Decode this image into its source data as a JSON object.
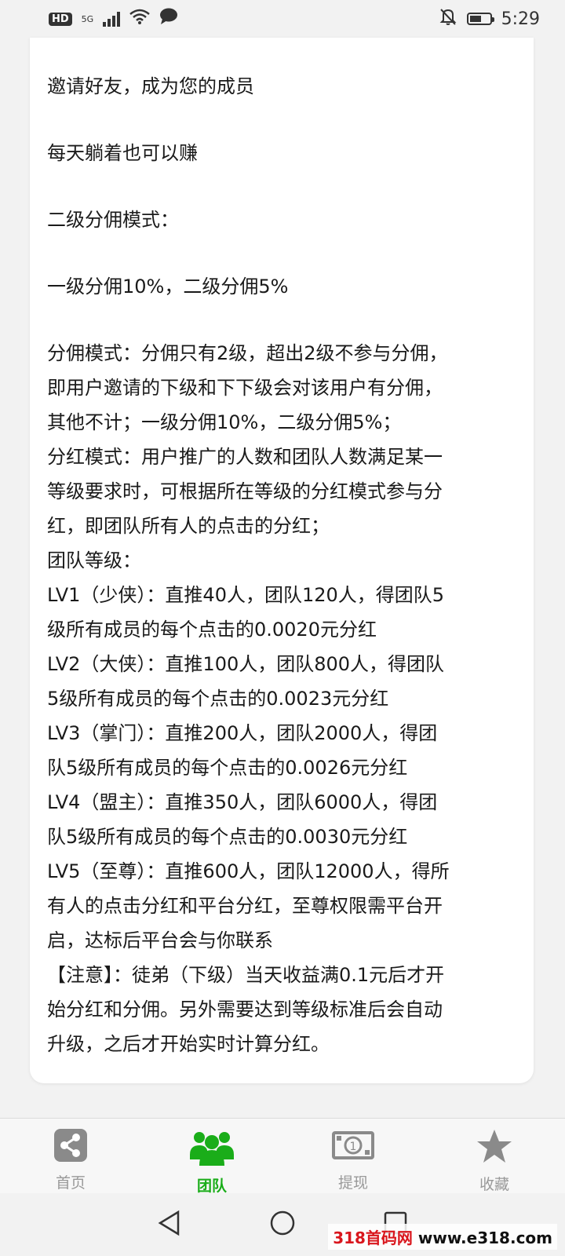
{
  "status_bar": {
    "hd": "HD",
    "network": "5G",
    "time": "5:29"
  },
  "content": {
    "paragraphs": [
      "邀请好友，成为您的成员",
      "每天躺着也可以赚",
      "二级分佣模式：",
      "一级分佣10%，二级分佣5%"
    ],
    "block": [
      "分佣模式：分佣只有2级，超出2级不参与分佣，",
      "即用户邀请的下级和下下级会对该用户有分佣，",
      "其他不计；一级分佣10%，二级分佣5%；",
      "分红模式：用户推广的人数和团队人数满足某一",
      "等级要求时，可根据所在等级的分红模式参与分",
      "红，即团队所有人的点击的分红；",
      "团队等级：",
      "LV1（少侠）：直推40人，团队120人，得团队5",
      "级所有成员的每个点击的0.0020元分红",
      "LV2（大侠）：直推100人，团队800人，得团队",
      "5级所有成员的每个点击的0.0023元分红",
      "LV3（掌门）：直推200人，团队2000人，得团",
      "队5级所有成员的每个点击的0.0026元分红",
      "LV4（盟主）：直推350人，团队6000人，得团",
      "队5级所有成员的每个点击的0.0030元分红",
      "LV5（至尊）：直推600人，团队12000人，得所",
      "有人的点击分红和平台分红，至尊权限需平台开",
      "启，达标后平台会与你联系",
      "【注意】：徒弟（下级）当天收益满0.1元后才开",
      "始分红和分佣。另外需要达到等级标准后会自动",
      "升级，之后才开始实时计算分红。"
    ]
  },
  "tabbar": {
    "home": "首页",
    "team": "团队",
    "withdraw": "提现",
    "favorites": "收藏"
  },
  "colors": {
    "active": "#1aad19",
    "inactive": "#999999",
    "card": "#ffffff",
    "background": "#f2f2f2"
  },
  "watermark": {
    "brand": "318首码网",
    "url": "www.e318.com"
  }
}
